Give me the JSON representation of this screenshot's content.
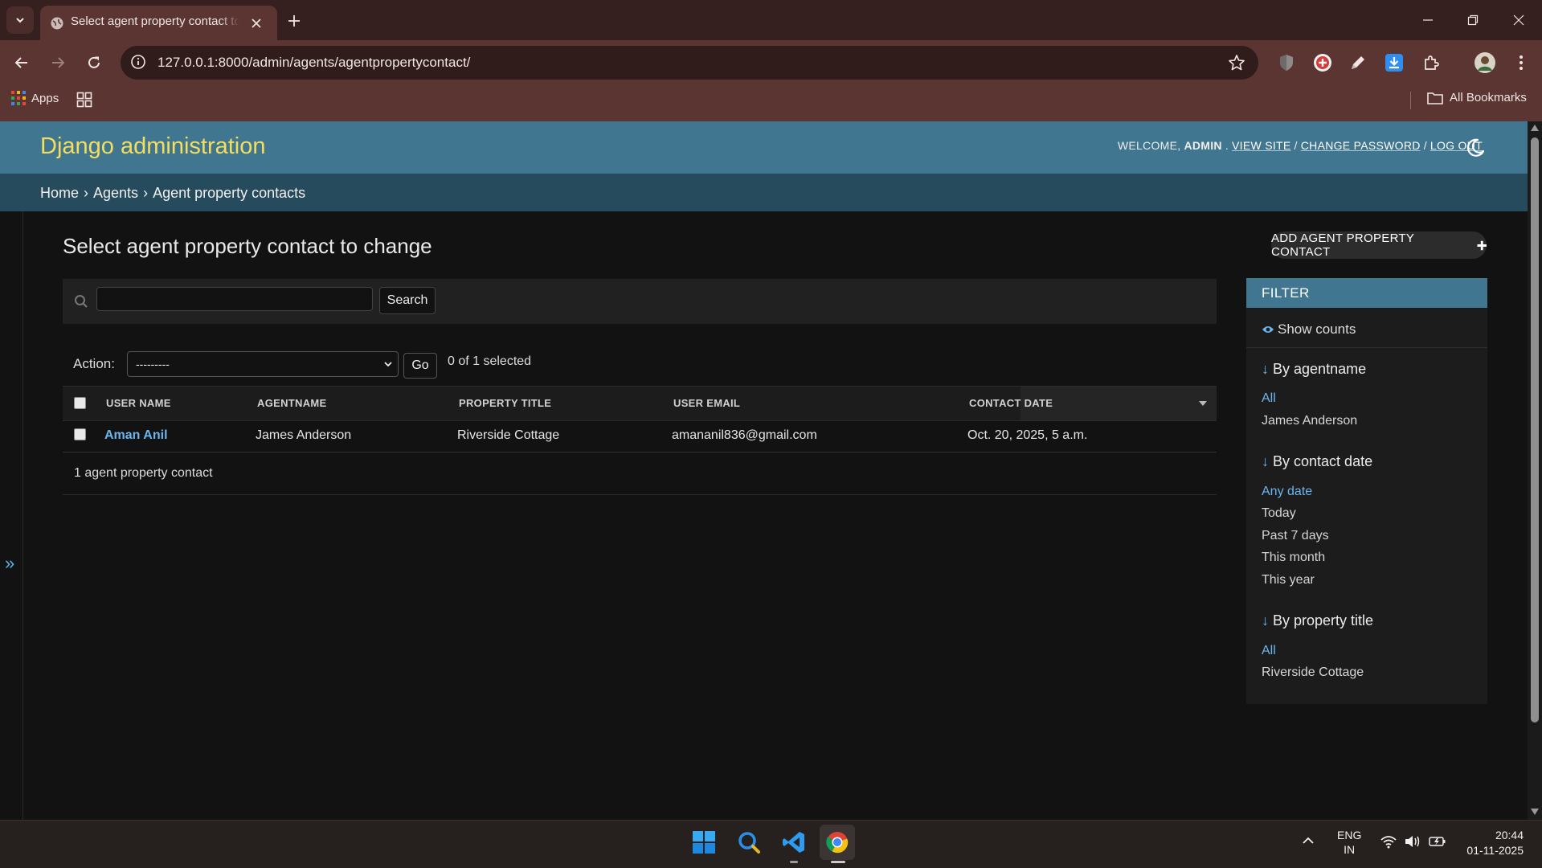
{
  "browser": {
    "tab_title": "Select agent property contact to change | Django site admin",
    "url": "127.0.0.1:8000/admin/agents/agentpropertycontact/",
    "bookmarks": {
      "apps_label": "Apps",
      "all_bookmarks_label": "All Bookmarks"
    },
    "icons": [
      "tab-search-icon",
      "globe-icon",
      "close-icon",
      "plus-icon",
      "minimize-icon",
      "restore-icon",
      "close-window-icon",
      "back-icon",
      "forward-icon",
      "reload-icon",
      "site-info-icon",
      "star-icon",
      "shield-extension-icon",
      "extension-icon",
      "pen-extension-icon",
      "download-icon",
      "puzzle-icon",
      "profile-avatar",
      "more-icon"
    ]
  },
  "admin": {
    "branding": "Django administration",
    "user_tools": {
      "welcome": "WELCOME,",
      "username": "ADMIN",
      "view_site": "VIEW SITE",
      "change_password": "CHANGE PASSWORD",
      "log_out": "LOG OUT",
      "sep": "/",
      "dot": "."
    },
    "breadcrumbs": {
      "home": "Home",
      "app": "Agents",
      "model": "Agent property contacts",
      "sep": "›"
    },
    "nav_toggle": "»",
    "page_title": "Select agent property contact to change",
    "add_button": "ADD AGENT PROPERTY CONTACT",
    "search": {
      "button": "Search",
      "value": ""
    },
    "actions": {
      "label": "Action:",
      "selected": "---------",
      "go": "Go",
      "count": "0 of 1 selected"
    },
    "table": {
      "headers": [
        "USER NAME",
        "AGENTNAME",
        "PROPERTY TITLE",
        "USER EMAIL",
        "CONTACT DATE"
      ],
      "rows": [
        {
          "user_name": "Aman Anil",
          "agentname": "James Anderson",
          "property_title": "Riverside Cottage",
          "user_email": "amananil836@gmail.com",
          "contact_date": "Oct. 20, 2025, 5 a.m."
        }
      ],
      "result_count": "1 agent property contact"
    },
    "filter": {
      "title": "FILTER",
      "show_counts": "Show counts",
      "arrow": "↓",
      "groups": [
        {
          "title": "By agentname",
          "items": [
            "All",
            "James Anderson"
          ],
          "selected": "All"
        },
        {
          "title": "By contact date",
          "items": [
            "Any date",
            "Today",
            "Past 7 days",
            "This month",
            "This year"
          ],
          "selected": "Any date"
        },
        {
          "title": "By property title",
          "items": [
            "All",
            "Riverside Cottage"
          ],
          "selected": "All"
        }
      ]
    },
    "colors": {
      "header": "#417690",
      "breadcrumbs": "#264b5d",
      "branding": "#f5dd5d",
      "link": "#6bb6ef"
    }
  },
  "taskbar": {
    "language": "ENG",
    "region": "IN",
    "time": "20:44",
    "date": "01-11-2025",
    "apps": [
      "windows-start-icon",
      "search-icon",
      "vscode-icon",
      "chrome-icon"
    ]
  }
}
